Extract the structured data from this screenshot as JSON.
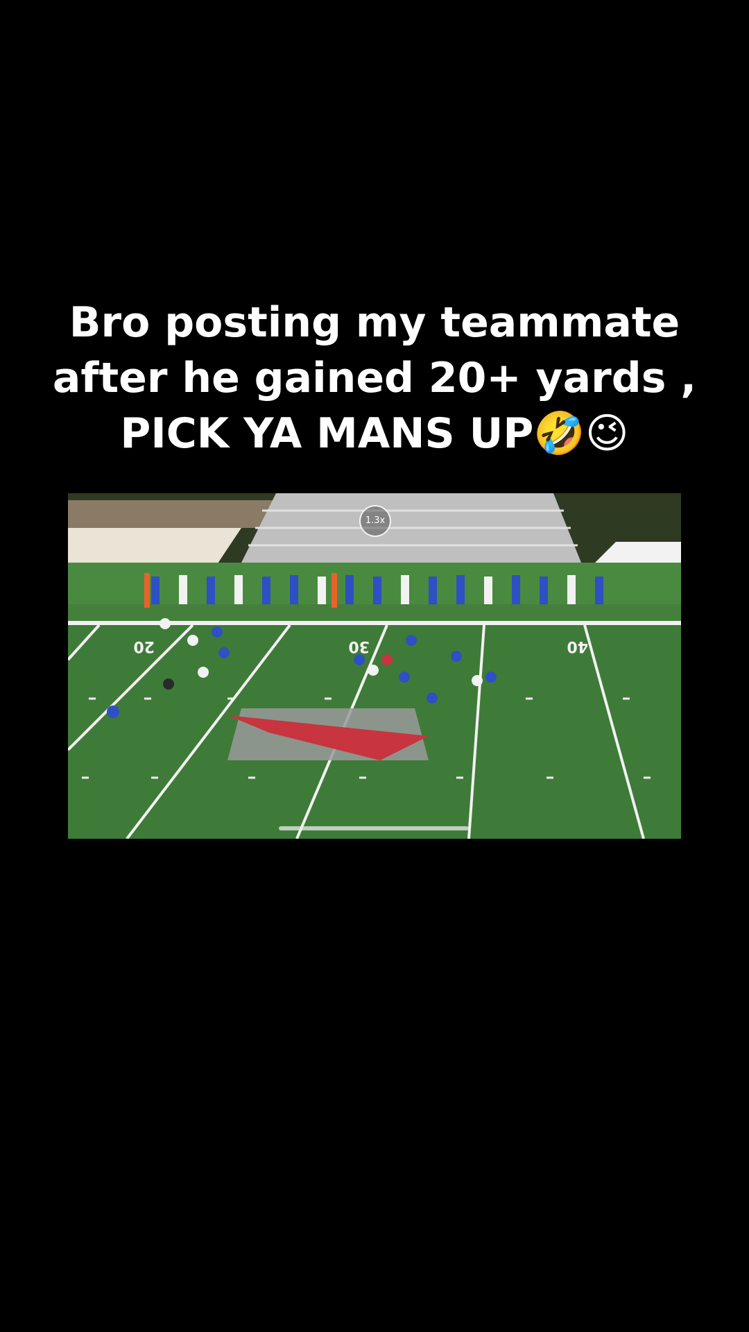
{
  "post": {
    "caption_lines": [
      "Bro posting my teammate",
      "after he gained 20+ yards ,",
      "PICK YA MANS UP🤣😉"
    ]
  },
  "video": {
    "zoom_label": "1.3x",
    "progress_fraction": 0.0,
    "field_numbers": [
      "20",
      "30",
      "40"
    ],
    "colors": {
      "turf": "#3f7b38",
      "turf_dark": "#356b30",
      "logo_red": "#c8343f",
      "home_jersey": "#2f4fc4",
      "away_jersey": "#f2f2f2"
    }
  }
}
